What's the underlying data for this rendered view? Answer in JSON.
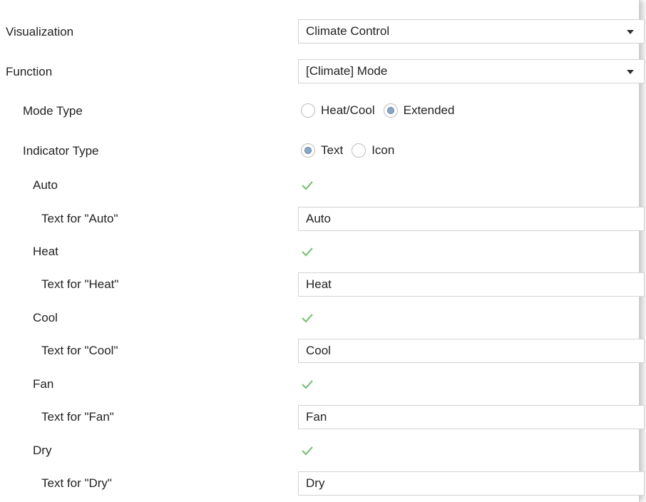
{
  "visualization": {
    "label": "Visualization",
    "value": "Climate Control"
  },
  "function": {
    "label": "Function",
    "value": "[Climate] Mode"
  },
  "mode_type": {
    "label": "Mode Type",
    "options": [
      {
        "label": "Heat/Cool",
        "checked": false
      },
      {
        "label": "Extended",
        "checked": true
      }
    ]
  },
  "indicator_type": {
    "label": "Indicator Type",
    "options": [
      {
        "label": "Text",
        "checked": true
      },
      {
        "label": "Icon",
        "checked": false
      }
    ]
  },
  "modes": [
    {
      "label": "Auto",
      "checked": true,
      "text_label": "Text for \"Auto\"",
      "text_value": "Auto"
    },
    {
      "label": "Heat",
      "checked": true,
      "text_label": "Text for \"Heat\"",
      "text_value": "Heat"
    },
    {
      "label": "Cool",
      "checked": true,
      "text_label": "Text for \"Cool\"",
      "text_value": "Cool"
    },
    {
      "label": "Fan",
      "checked": true,
      "text_label": "Text for \"Fan\"",
      "text_value": "Fan"
    },
    {
      "label": "Dry",
      "checked": true,
      "text_label": "Text for \"Dry\"",
      "text_value": "Dry"
    }
  ],
  "colors": {
    "check": "#7ec07e",
    "radio_fill": "#8aa7c7",
    "border": "#d3d3d3"
  },
  "icons": {
    "checkbox": "check-icon",
    "dropdown": "chevron-down-icon"
  }
}
